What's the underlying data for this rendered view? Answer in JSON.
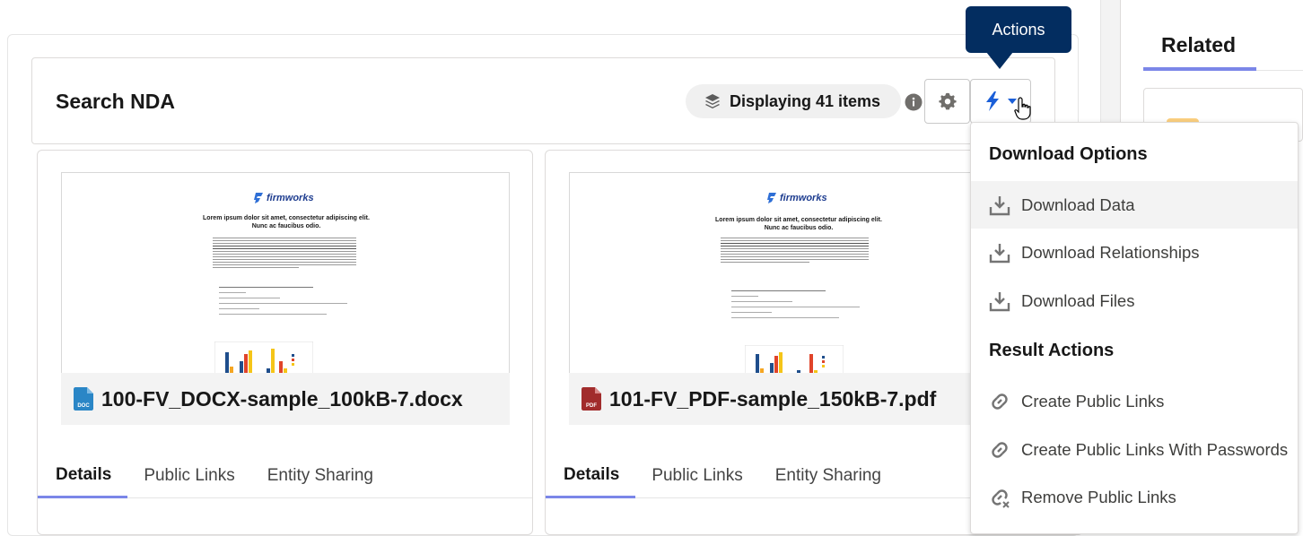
{
  "header": {
    "title": "Search NDA",
    "displaying": "Displaying 41 items",
    "actions_tooltip": "Actions"
  },
  "cards": [
    {
      "file_name": "100-FV_DOCX-sample_100kB-7.docx",
      "file_type": "DOC",
      "file_color": "#2a86c6",
      "tabs": [
        "Details",
        "Public Links",
        "Entity Sharing"
      ],
      "active_tab": "Details"
    },
    {
      "file_name": "101-FV_PDF-sample_150kB-7.pdf",
      "file_type": "PDF",
      "file_color": "#a12c2c",
      "tabs": [
        "Details",
        "Public Links",
        "Entity Sharing"
      ],
      "active_tab": "Details"
    }
  ],
  "preview": {
    "brand": "firmworks",
    "heading": "Lorem ipsum dolor sit amet, consectetur adipiscing elit. Nunc ac faucibus odio."
  },
  "related": {
    "title": "Related"
  },
  "dropdown": {
    "download_section": "Download Options",
    "download_items": [
      "Download Data",
      "Download Relationships",
      "Download Files"
    ],
    "result_section": "Result Actions",
    "result_items": [
      "Create Public Links",
      "Create Public Links With Passwords",
      "Remove Public Links"
    ]
  },
  "colors": {
    "accent": "#7b86e8",
    "tooltip_bg": "#032d60",
    "lightning": "#1b5fd8"
  }
}
